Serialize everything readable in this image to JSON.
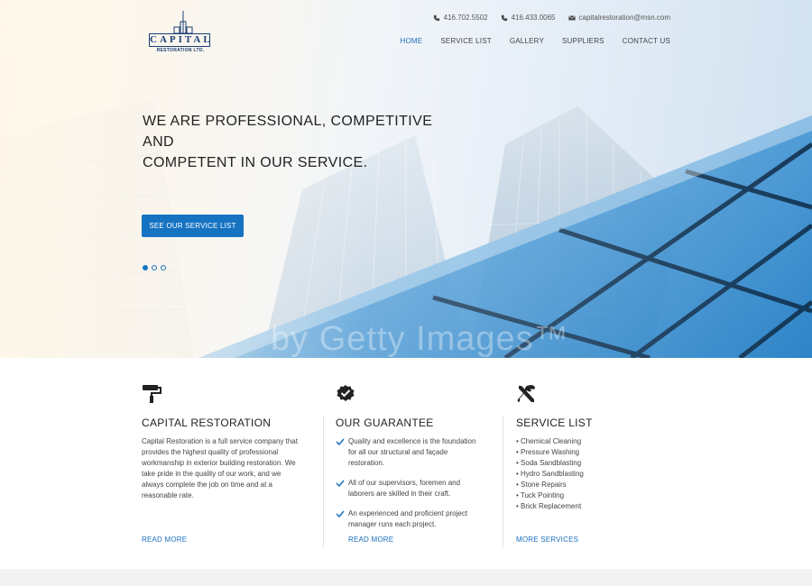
{
  "brand": {
    "logo_word": "CAPITAL",
    "logo_sub": "RESTORATION LTD."
  },
  "contact": {
    "phone1": "416.702.5502",
    "phone2": "416.433.0065",
    "email": "capitalrestoration@msn.com"
  },
  "nav": {
    "items": [
      {
        "label": "HOME",
        "active": true
      },
      {
        "label": "SERVICE LIST"
      },
      {
        "label": "GALLERY"
      },
      {
        "label": "SUPPLIERS"
      },
      {
        "label": "CONTACT US"
      }
    ]
  },
  "hero": {
    "title_line1": "WE ARE PROFESSIONAL, COMPETITIVE AND",
    "title_line2": "COMPETENT IN OUR SERVICE.",
    "cta": "SEE OUR SERVICE LIST",
    "slides": 3,
    "active_slide": 1,
    "watermark": "by Getty Images™"
  },
  "features": {
    "col1": {
      "icon": "paint-roller-icon",
      "title": "CAPITAL RESTORATION",
      "body": "Capital Restoration is a full service company that provides the highest quality of professional workmanship in exterior building restoration. We take pride in the quality of our work, and we always complete the job on time and at a reasonable rate.",
      "link": "READ MORE"
    },
    "col2": {
      "icon": "badge-check-icon",
      "title": "OUR GUARANTEE",
      "items": [
        "Quality and excellence is the foundation for all our structural and façade restoration.",
        "All of our supervisors, foremen and laborers are skilled in their craft.",
        "An experienced and proficient project manager runs each project."
      ],
      "link": "READ MORE"
    },
    "col3": {
      "icon": "tools-icon",
      "title": "SERVICE LIST",
      "items": [
        "Chemical Cleaning",
        "Pressure Washing",
        "Soda Sandblasting",
        "Hydro Sandblasting",
        "Stone Repairs",
        "Tuck Pointing",
        "Brick Replacement"
      ],
      "link": "MORE SERVICES"
    }
  },
  "colors": {
    "accent": "#1573c2",
    "link": "#1a6fbd",
    "logo": "#1b3f76"
  }
}
